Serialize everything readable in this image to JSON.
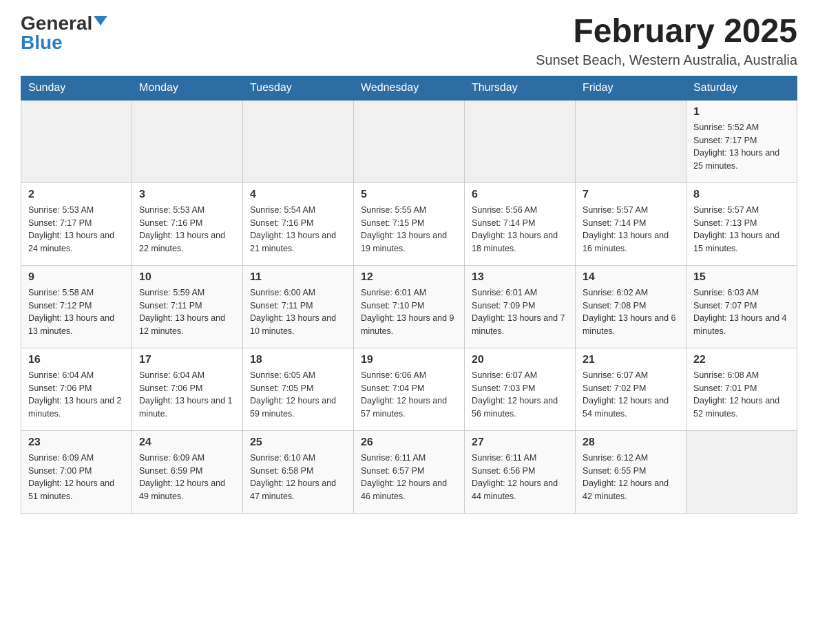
{
  "header": {
    "logo_general": "General",
    "logo_blue": "Blue",
    "month_year": "February 2025",
    "location": "Sunset Beach, Western Australia, Australia"
  },
  "weekdays": [
    "Sunday",
    "Monday",
    "Tuesday",
    "Wednesday",
    "Thursday",
    "Friday",
    "Saturday"
  ],
  "weeks": [
    [
      {
        "day": "",
        "info": ""
      },
      {
        "day": "",
        "info": ""
      },
      {
        "day": "",
        "info": ""
      },
      {
        "day": "",
        "info": ""
      },
      {
        "day": "",
        "info": ""
      },
      {
        "day": "",
        "info": ""
      },
      {
        "day": "1",
        "info": "Sunrise: 5:52 AM\nSunset: 7:17 PM\nDaylight: 13 hours and 25 minutes."
      }
    ],
    [
      {
        "day": "2",
        "info": "Sunrise: 5:53 AM\nSunset: 7:17 PM\nDaylight: 13 hours and 24 minutes."
      },
      {
        "day": "3",
        "info": "Sunrise: 5:53 AM\nSunset: 7:16 PM\nDaylight: 13 hours and 22 minutes."
      },
      {
        "day": "4",
        "info": "Sunrise: 5:54 AM\nSunset: 7:16 PM\nDaylight: 13 hours and 21 minutes."
      },
      {
        "day": "5",
        "info": "Sunrise: 5:55 AM\nSunset: 7:15 PM\nDaylight: 13 hours and 19 minutes."
      },
      {
        "day": "6",
        "info": "Sunrise: 5:56 AM\nSunset: 7:14 PM\nDaylight: 13 hours and 18 minutes."
      },
      {
        "day": "7",
        "info": "Sunrise: 5:57 AM\nSunset: 7:14 PM\nDaylight: 13 hours and 16 minutes."
      },
      {
        "day": "8",
        "info": "Sunrise: 5:57 AM\nSunset: 7:13 PM\nDaylight: 13 hours and 15 minutes."
      }
    ],
    [
      {
        "day": "9",
        "info": "Sunrise: 5:58 AM\nSunset: 7:12 PM\nDaylight: 13 hours and 13 minutes."
      },
      {
        "day": "10",
        "info": "Sunrise: 5:59 AM\nSunset: 7:11 PM\nDaylight: 13 hours and 12 minutes."
      },
      {
        "day": "11",
        "info": "Sunrise: 6:00 AM\nSunset: 7:11 PM\nDaylight: 13 hours and 10 minutes."
      },
      {
        "day": "12",
        "info": "Sunrise: 6:01 AM\nSunset: 7:10 PM\nDaylight: 13 hours and 9 minutes."
      },
      {
        "day": "13",
        "info": "Sunrise: 6:01 AM\nSunset: 7:09 PM\nDaylight: 13 hours and 7 minutes."
      },
      {
        "day": "14",
        "info": "Sunrise: 6:02 AM\nSunset: 7:08 PM\nDaylight: 13 hours and 6 minutes."
      },
      {
        "day": "15",
        "info": "Sunrise: 6:03 AM\nSunset: 7:07 PM\nDaylight: 13 hours and 4 minutes."
      }
    ],
    [
      {
        "day": "16",
        "info": "Sunrise: 6:04 AM\nSunset: 7:06 PM\nDaylight: 13 hours and 2 minutes."
      },
      {
        "day": "17",
        "info": "Sunrise: 6:04 AM\nSunset: 7:06 PM\nDaylight: 13 hours and 1 minute."
      },
      {
        "day": "18",
        "info": "Sunrise: 6:05 AM\nSunset: 7:05 PM\nDaylight: 12 hours and 59 minutes."
      },
      {
        "day": "19",
        "info": "Sunrise: 6:06 AM\nSunset: 7:04 PM\nDaylight: 12 hours and 57 minutes."
      },
      {
        "day": "20",
        "info": "Sunrise: 6:07 AM\nSunset: 7:03 PM\nDaylight: 12 hours and 56 minutes."
      },
      {
        "day": "21",
        "info": "Sunrise: 6:07 AM\nSunset: 7:02 PM\nDaylight: 12 hours and 54 minutes."
      },
      {
        "day": "22",
        "info": "Sunrise: 6:08 AM\nSunset: 7:01 PM\nDaylight: 12 hours and 52 minutes."
      }
    ],
    [
      {
        "day": "23",
        "info": "Sunrise: 6:09 AM\nSunset: 7:00 PM\nDaylight: 12 hours and 51 minutes."
      },
      {
        "day": "24",
        "info": "Sunrise: 6:09 AM\nSunset: 6:59 PM\nDaylight: 12 hours and 49 minutes."
      },
      {
        "day": "25",
        "info": "Sunrise: 6:10 AM\nSunset: 6:58 PM\nDaylight: 12 hours and 47 minutes."
      },
      {
        "day": "26",
        "info": "Sunrise: 6:11 AM\nSunset: 6:57 PM\nDaylight: 12 hours and 46 minutes."
      },
      {
        "day": "27",
        "info": "Sunrise: 6:11 AM\nSunset: 6:56 PM\nDaylight: 12 hours and 44 minutes."
      },
      {
        "day": "28",
        "info": "Sunrise: 6:12 AM\nSunset: 6:55 PM\nDaylight: 12 hours and 42 minutes."
      },
      {
        "day": "",
        "info": ""
      }
    ]
  ]
}
